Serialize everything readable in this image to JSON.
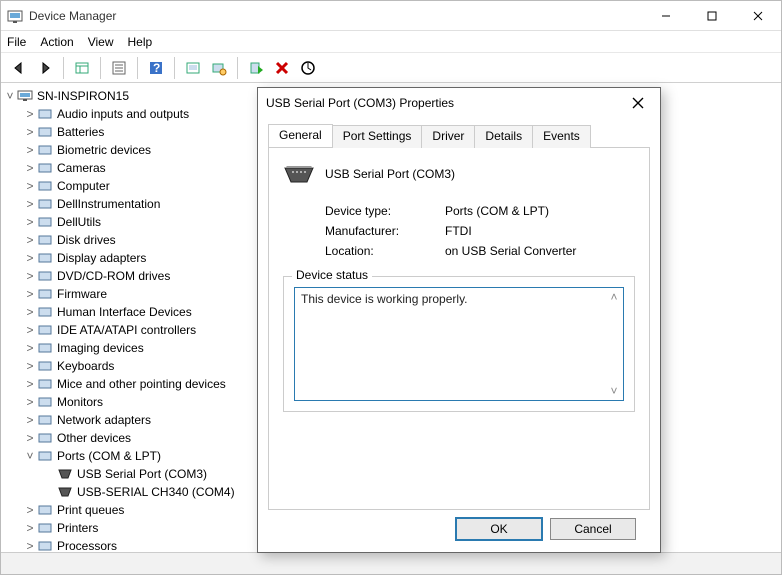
{
  "window": {
    "title": "Device Manager",
    "menus": {
      "file": "File",
      "action": "Action",
      "view": "View",
      "help": "Help"
    }
  },
  "tree": {
    "root": "SN-INSPIRON15",
    "nodes": [
      {
        "label": "Audio inputs and outputs",
        "expandable": true
      },
      {
        "label": "Batteries",
        "expandable": true
      },
      {
        "label": "Biometric devices",
        "expandable": true
      },
      {
        "label": "Cameras",
        "expandable": true
      },
      {
        "label": "Computer",
        "expandable": true
      },
      {
        "label": "DellInstrumentation",
        "expandable": true
      },
      {
        "label": "DellUtils",
        "expandable": true
      },
      {
        "label": "Disk drives",
        "expandable": true
      },
      {
        "label": "Display adapters",
        "expandable": true
      },
      {
        "label": "DVD/CD-ROM drives",
        "expandable": true
      },
      {
        "label": "Firmware",
        "expandable": true
      },
      {
        "label": "Human Interface Devices",
        "expandable": true
      },
      {
        "label": "IDE ATA/ATAPI controllers",
        "expandable": true
      },
      {
        "label": "Imaging devices",
        "expandable": true
      },
      {
        "label": "Keyboards",
        "expandable": true
      },
      {
        "label": "Mice and other pointing devices",
        "expandable": true
      },
      {
        "label": "Monitors",
        "expandable": true
      },
      {
        "label": "Network adapters",
        "expandable": true
      },
      {
        "label": "Other devices",
        "expandable": true
      },
      {
        "label": "Ports (COM & LPT)",
        "expandable": true,
        "expanded": true,
        "children": [
          {
            "label": "USB Serial Port (COM3)"
          },
          {
            "label": "USB-SERIAL CH340 (COM4)"
          }
        ]
      },
      {
        "label": "Print queues",
        "expandable": true
      },
      {
        "label": "Printers",
        "expandable": true
      },
      {
        "label": "Processors",
        "expandable": true
      }
    ]
  },
  "dialog": {
    "title": "USB Serial Port (COM3) Properties",
    "tabs": {
      "general": "General",
      "port_settings": "Port Settings",
      "driver": "Driver",
      "details": "Details",
      "events": "Events"
    },
    "device_name": "USB Serial Port (COM3)",
    "rows": {
      "device_type_label": "Device type:",
      "device_type_value": "Ports (COM & LPT)",
      "manufacturer_label": "Manufacturer:",
      "manufacturer_value": "FTDI",
      "location_label": "Location:",
      "location_value": "on USB Serial Converter"
    },
    "status_legend": "Device status",
    "status_text": "This device is working properly.",
    "buttons": {
      "ok": "OK",
      "cancel": "Cancel"
    }
  }
}
